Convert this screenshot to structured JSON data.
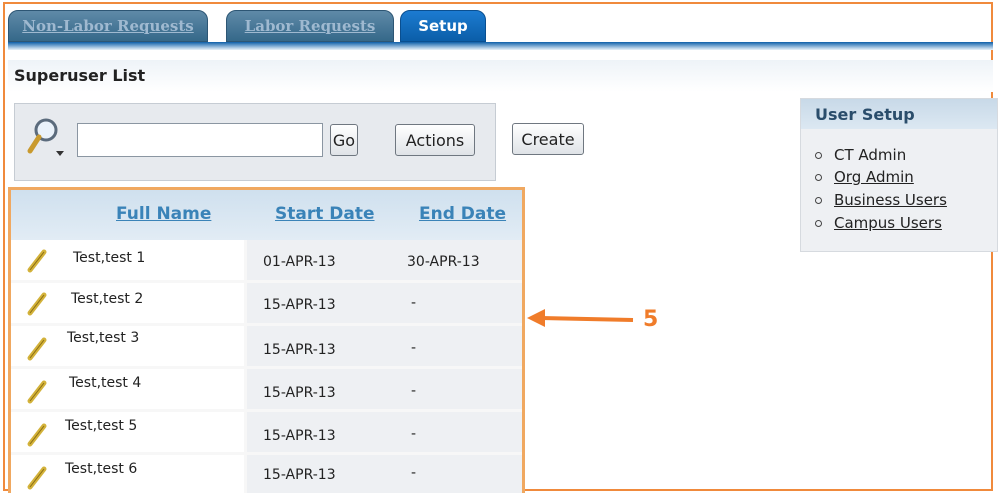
{
  "tabs": [
    {
      "label": "Non-Labor Requests",
      "active": false
    },
    {
      "label": "Labor Requests",
      "active": false
    },
    {
      "label": "Setup",
      "active": true
    }
  ],
  "page": {
    "title": "Superuser List"
  },
  "search": {
    "value": "",
    "go_label": "Go",
    "actions_label": "Actions",
    "create_label": "Create"
  },
  "table": {
    "columns": [
      "Full Name",
      "Start Date",
      "End Date"
    ],
    "rows": [
      {
        "name": "Test,test 1",
        "start": "01-APR-13",
        "end": "30-APR-13"
      },
      {
        "name": "Test,test 2",
        "start": "15-APR-13",
        "end": "-"
      },
      {
        "name": "Test,test 3",
        "start": "15-APR-13",
        "end": "-"
      },
      {
        "name": "Test,test 4",
        "start": "15-APR-13",
        "end": "-"
      },
      {
        "name": "Test,test 5",
        "start": "15-APR-13",
        "end": "-"
      },
      {
        "name": "Test,test 6",
        "start": "15-APR-13",
        "end": "-"
      }
    ]
  },
  "user_setup": {
    "title": "User Setup",
    "items": [
      "CT Admin",
      "Org Admin",
      "Business Users",
      "Campus Users"
    ]
  },
  "callout": {
    "number": "5"
  },
  "colors": {
    "accent_orange": "#f07c2a",
    "tab_active": "#0b5ea8",
    "link_blue": "#3a83b8"
  },
  "icons": {
    "search": "search-icon",
    "edit": "pencil-icon",
    "bullet": "circle-bullet"
  }
}
